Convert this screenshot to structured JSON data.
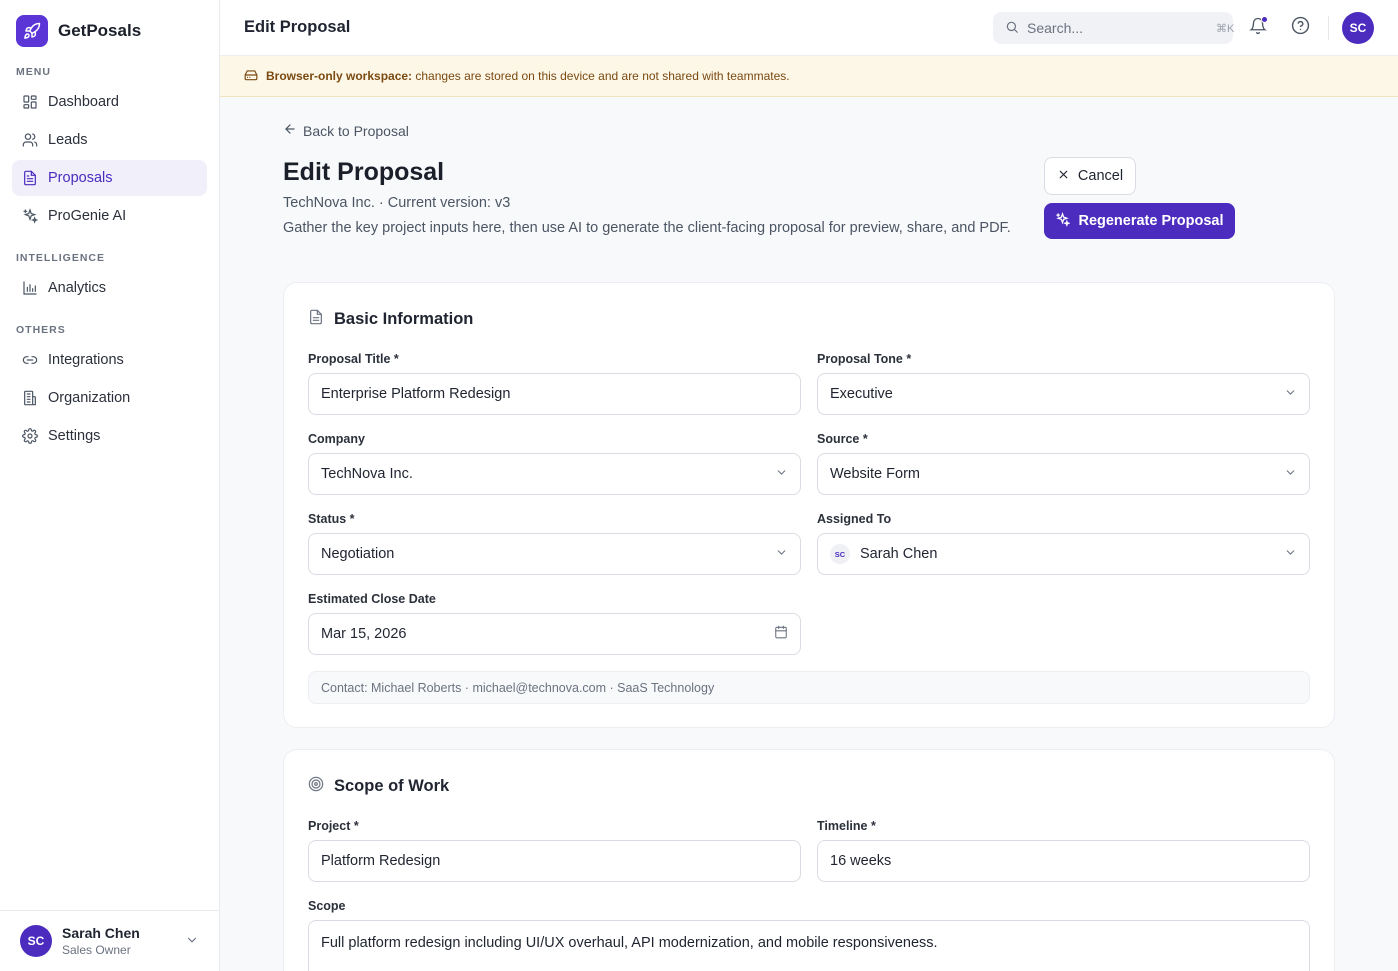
{
  "brand": {
    "name": "GetPosals"
  },
  "sidebar": {
    "sections": {
      "menu": "MENU",
      "intelligence": "INTELLIGENCE",
      "others": "OTHERS"
    },
    "items": [
      {
        "label": "Dashboard",
        "icon": "dashboard-icon"
      },
      {
        "label": "Leads",
        "icon": "users-icon"
      },
      {
        "label": "Proposals",
        "icon": "document-icon",
        "active": true
      },
      {
        "label": "ProGenie AI",
        "icon": "sparkle-icon"
      },
      {
        "label": "Analytics",
        "icon": "bar-chart-icon"
      },
      {
        "label": "Integrations",
        "icon": "link-icon"
      },
      {
        "label": "Organization",
        "icon": "building-icon"
      },
      {
        "label": "Settings",
        "icon": "gear-icon"
      }
    ],
    "user": {
      "initials": "SC",
      "name": "Sarah Chen",
      "role": "Sales Owner"
    }
  },
  "topbar": {
    "title": "Edit Proposal",
    "search_placeholder": "Search...",
    "search_shortcut": "⌘K",
    "avatar_initials": "SC"
  },
  "banner": {
    "bold": "Browser-only workspace:",
    "text": " changes are stored on this device and are not shared with teammates."
  },
  "page": {
    "back_label": "Back to Proposal",
    "title": "Edit Proposal",
    "subtitle": "TechNova Inc. · Current version: v3",
    "description": "Gather the key project inputs here, then use AI to generate the client-facing proposal for preview, share, and PDF.",
    "cancel_label": "Cancel",
    "regenerate_label": "Regenerate Proposal"
  },
  "basic_info": {
    "heading": "Basic Information",
    "proposal_title_label": "Proposal Title *",
    "proposal_title_value": "Enterprise Platform Redesign",
    "tone_label": "Proposal Tone *",
    "tone_value": "Executive",
    "company_label": "Company",
    "company_value": "TechNova Inc.",
    "source_label": "Source *",
    "source_value": "Website Form",
    "status_label": "Status *",
    "status_value": "Negotiation",
    "assigned_label": "Assigned To",
    "assigned_initials": "SC",
    "assigned_value": "Sarah Chen",
    "close_date_label": "Estimated Close Date",
    "close_date_value": "Mar 15, 2026",
    "contact": "Contact: Michael Roberts · michael@technova.com · SaaS Technology"
  },
  "scope": {
    "heading": "Scope of Work",
    "project_label": "Project *",
    "project_value": "Platform Redesign",
    "timeline_label": "Timeline *",
    "timeline_value": "16 weeks",
    "scope_label": "Scope",
    "scope_value": "Full platform redesign including UI/UX overhaul, API modernization, and mobile responsiveness."
  },
  "colors": {
    "accent": "#4b2cbf",
    "banner_bg": "#fdf7e7",
    "banner_text": "#7a4a12"
  }
}
